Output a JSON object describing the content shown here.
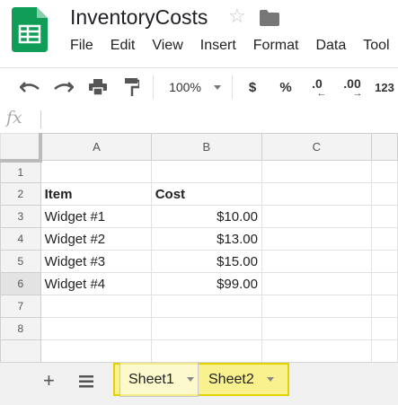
{
  "doc": {
    "title": "InventoryCosts"
  },
  "menu": [
    "File",
    "Edit",
    "View",
    "Insert",
    "Format",
    "Data",
    "Tool"
  ],
  "toolbar": {
    "zoom": "100%",
    "currency": "$",
    "percent": "%",
    "dec_less": ".0",
    "dec_more": ".00",
    "more_formats": "123"
  },
  "formula_bar": {
    "fx": "fx",
    "value": ""
  },
  "columns": [
    "A",
    "B",
    "C"
  ],
  "rows": [
    {
      "num": "1",
      "a": "",
      "b": "",
      "c": ""
    },
    {
      "num": "2",
      "a": "Item",
      "b": "Cost",
      "c": ""
    },
    {
      "num": "3",
      "a": "Widget #1",
      "b": "$10.00",
      "c": ""
    },
    {
      "num": "4",
      "a": "Widget #2",
      "b": "$13.00",
      "c": ""
    },
    {
      "num": "5",
      "a": "Widget #3",
      "b": "$15.00",
      "c": ""
    },
    {
      "num": "6",
      "a": "Widget #4",
      "b": "$99.00",
      "c": ""
    },
    {
      "num": "7",
      "a": "",
      "b": "",
      "c": ""
    },
    {
      "num": "8",
      "a": "",
      "b": "",
      "c": ""
    }
  ],
  "sheets": [
    "Sheet1",
    "Sheet2"
  ],
  "colors": {
    "logo_green": "#0f9d58",
    "highlight": "#fff03c"
  }
}
